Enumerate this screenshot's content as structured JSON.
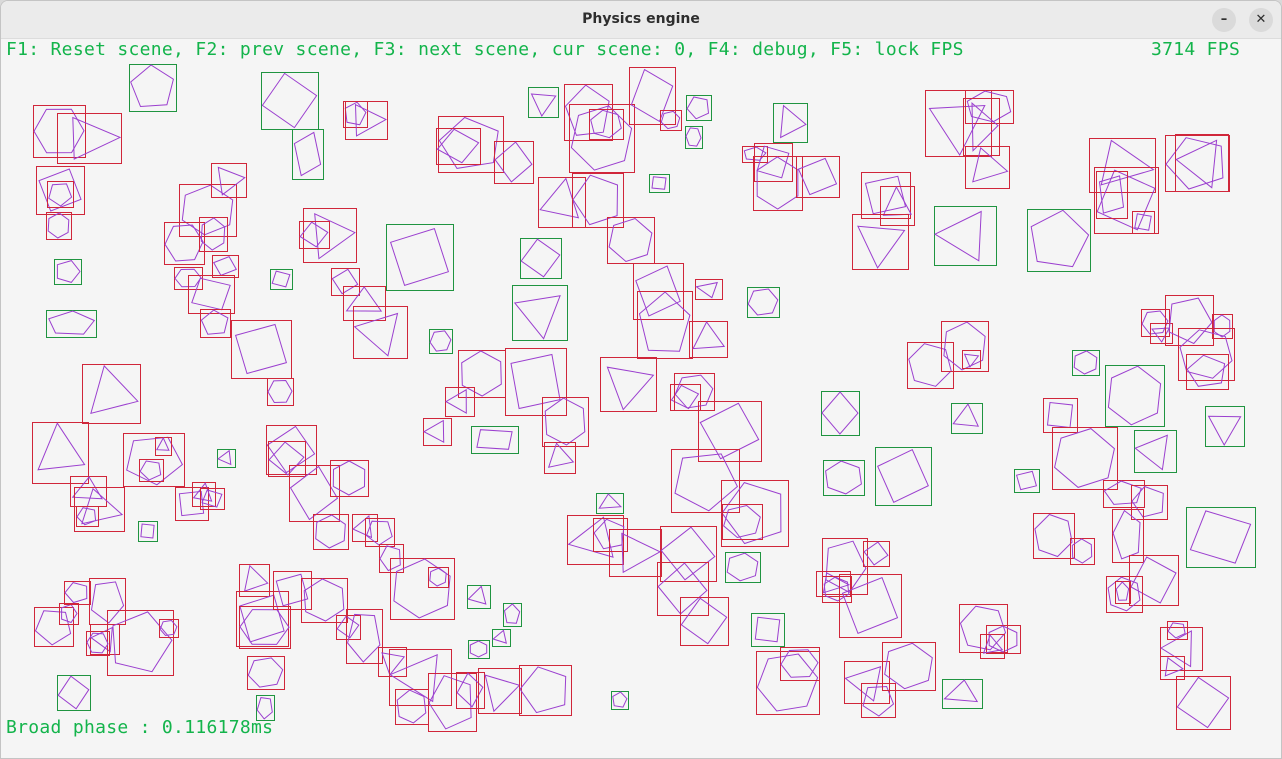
{
  "window": {
    "title": "Physics engine",
    "minimize_icon": "minimize-icon",
    "close_icon": "close-icon",
    "minimize_glyph": "–",
    "close_glyph": "✕"
  },
  "hud": {
    "help": "F1: Reset scene, F2: prev scene, F3: next scene, cur scene: 0, F4: debug, F5: lock FPS",
    "fps": "3714 FPS",
    "broad_phase": "Broad phase : 0.116178ms",
    "color": "#13b44b"
  },
  "colors": {
    "colliding_box": "#d0263a",
    "free_box": "#1f9440",
    "polygon": "#9b3fcf"
  }
}
